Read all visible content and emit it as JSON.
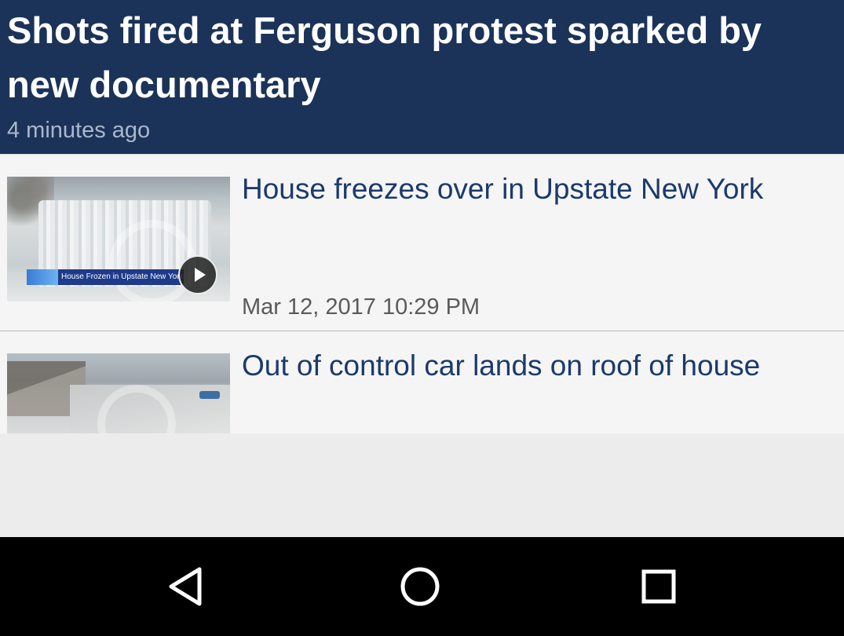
{
  "featured": {
    "title": "Shots fired at Ferguson protest sparked by new documentary",
    "time": "4 minutes ago"
  },
  "items": [
    {
      "title": "House freezes over in Upstate New York",
      "time": "Mar 12, 2017 10:29 PM",
      "thumbnail_caption": "House Frozen in Upstate New York",
      "has_video": true
    },
    {
      "title": "Out of control car lands on roof of house",
      "time": "",
      "has_video": false
    }
  ],
  "navbar": {
    "buttons": [
      "back-icon",
      "home-icon",
      "recents-icon"
    ]
  },
  "colors": {
    "header_bg": "#1b3358",
    "link_title": "#1b3a6b",
    "list_bg": "#f5f5f5",
    "navbar_bg": "#000000"
  }
}
